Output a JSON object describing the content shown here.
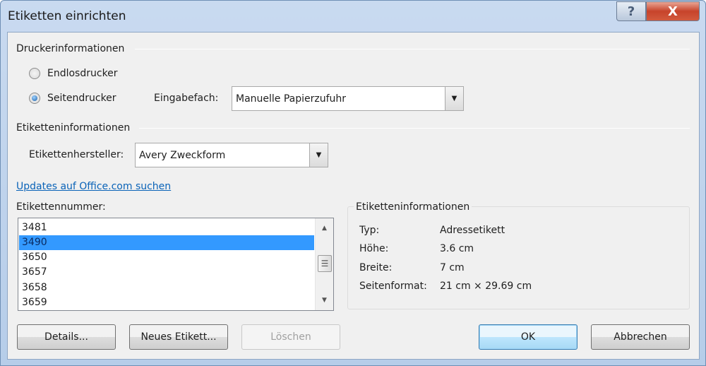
{
  "window": {
    "title": "Etiketten einrichten",
    "help": "?",
    "close": "X"
  },
  "printer": {
    "section": "Druckerinformationen",
    "continuous": "Endlosdrucker",
    "page": "Seitendrucker",
    "tray_label": "Eingabefach:",
    "tray_value": "Manuelle Papierzufuhr",
    "selected": "Seitendrucker"
  },
  "label": {
    "section": "Etiketteninformationen",
    "vendor_label": "Etikettenhersteller:",
    "vendor_value": "Avery Zweckform",
    "update_link": "Updates auf Office.com suchen",
    "number_label": "Etikettennummer:",
    "numbers": [
      "3481",
      "3490",
      "3650",
      "3657",
      "3658",
      "3659"
    ],
    "selected": "3490"
  },
  "info": {
    "title": "Etiketteninformationen",
    "rows": [
      {
        "label": "Typ:",
        "value": "Adressetikett"
      },
      {
        "label": "Höhe:",
        "value": "3.6 cm"
      },
      {
        "label": "Breite:",
        "value": "7 cm"
      },
      {
        "label": "Seitenformat:",
        "value": "21 cm × 29.69 cm"
      }
    ]
  },
  "buttons": {
    "details": "Details...",
    "new": "Neues Etikett...",
    "delete": "Löschen",
    "ok": "OK",
    "cancel": "Abbrechen"
  }
}
